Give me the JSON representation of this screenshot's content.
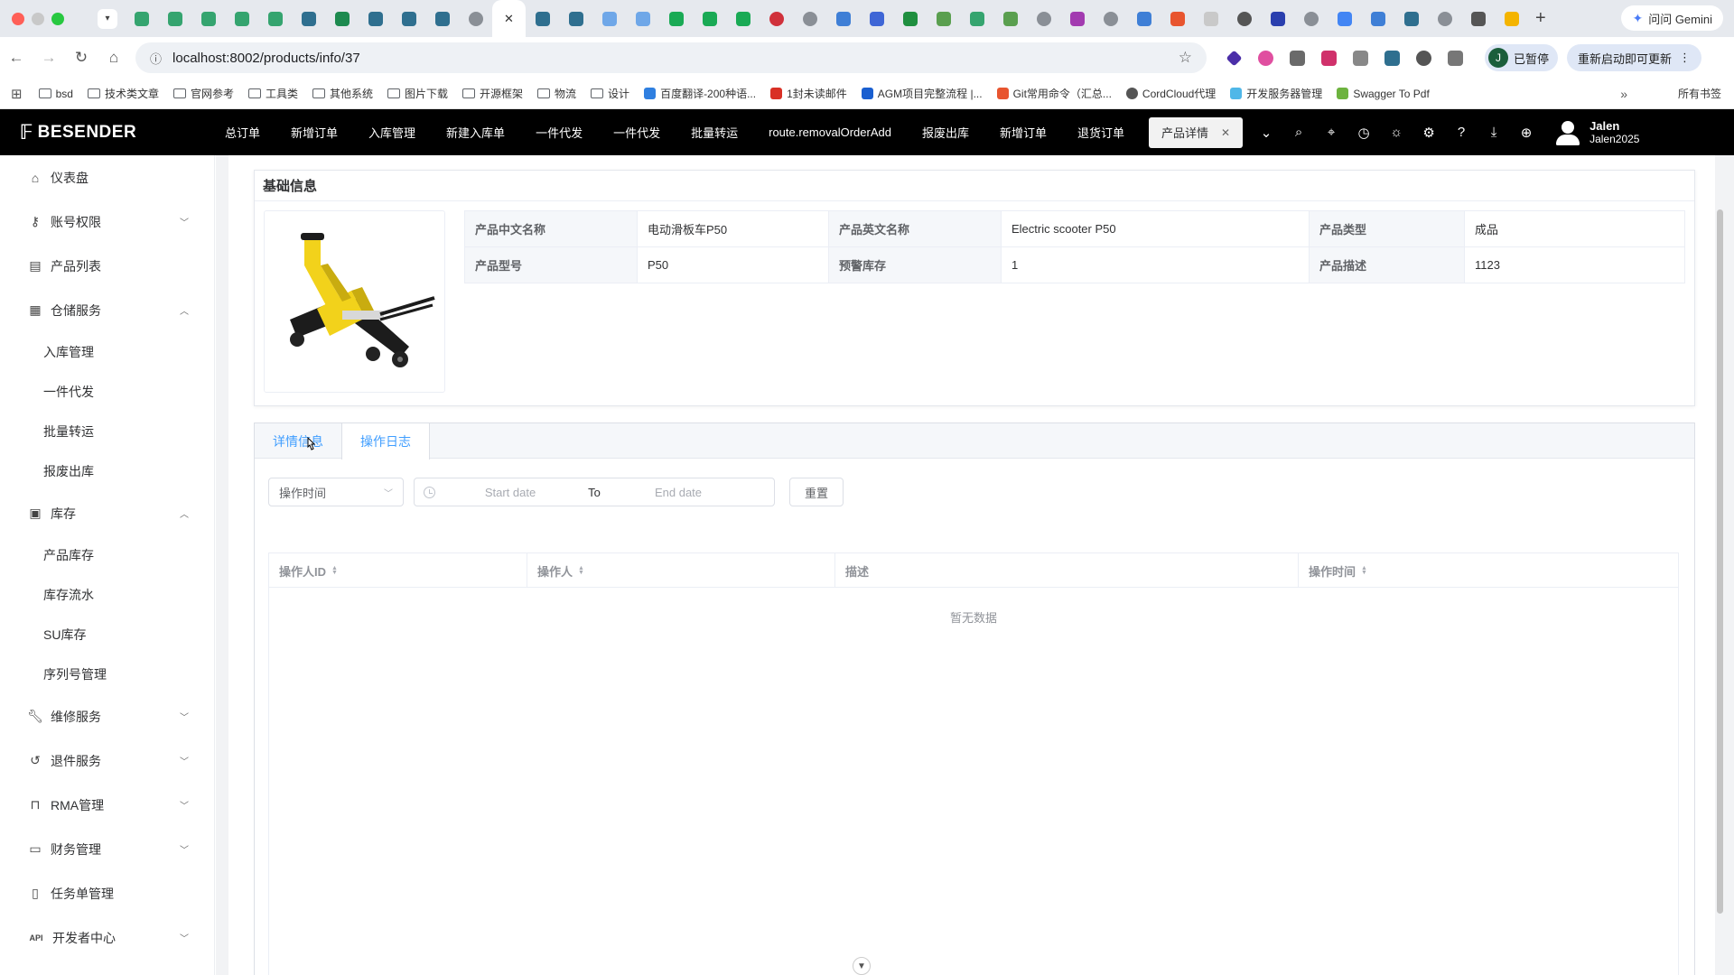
{
  "browser": {
    "url": "localhost:8002/products/info/37",
    "gemini_label": "问问 Gemini",
    "paused_avatar": "J",
    "paused_label": "已暂停",
    "restart_label": "重新启动即可更新",
    "bookmarks": [
      "bsd",
      "技术类文章",
      "官网参考",
      "工具类",
      "其他系统",
      "图片下载",
      "开源框架",
      "物流",
      "设计",
      "百度翻译-200种语...",
      "1封未读邮件",
      "AGM项目完整流程 |...",
      "Git常用命令（汇总...",
      "CordCloud代理",
      "开发服务器管理",
      "Swagger To Pdf"
    ],
    "all_bookmarks": "所有书签"
  },
  "header": {
    "brand": "BESENDER",
    "nav": [
      "总订单",
      "新增订单",
      "入库管理",
      "新建入库单",
      "一件代发",
      "一件代发",
      "批量转运",
      "route.removalOrderAdd",
      "报废出库",
      "新增订单",
      "退货订单"
    ],
    "active_tab": "产品详情",
    "user_name": "Jalen",
    "user_id": "Jalen2025"
  },
  "sidebar": {
    "dashboard": "仪表盘",
    "account": "账号权限",
    "product_list": "产品列表",
    "warehouse": "仓储服务",
    "warehouse_sub": [
      "入库管理",
      "一件代发",
      "批量转运",
      "报废出库"
    ],
    "stock": "库存",
    "stock_sub": [
      "产品库存",
      "库存流水",
      "SU库存",
      "序列号管理"
    ],
    "repair": "维修服务",
    "returns": "退件服务",
    "rma": "RMA管理",
    "finance": "财务管理",
    "tasks": "任务单管理",
    "api_tag": "API",
    "developer": "开发者中心"
  },
  "basic_info": {
    "title": "基础信息",
    "fields": {
      "cn_name_label": "产品中文名称",
      "cn_name": "电动滑板车P50",
      "en_name_label": "产品英文名称",
      "en_name": "Electric scooter P50",
      "type_label": "产品类型",
      "type": "成品",
      "model_label": "产品型号",
      "model": "P50",
      "alert_label": "预警库存",
      "alert": "1",
      "desc_label": "产品描述",
      "desc": "1123"
    }
  },
  "detail_tabs": {
    "tab1": "详情信息",
    "tab2": "操作日志"
  },
  "filters": {
    "select_value": "操作时间",
    "start_placeholder": "Start date",
    "range_sep": "To",
    "end_placeholder": "End date",
    "reset": "重置"
  },
  "log_table": {
    "columns": [
      "操作人ID",
      "操作人",
      "描述",
      "操作时间"
    ],
    "empty_text": "暂无数据"
  }
}
